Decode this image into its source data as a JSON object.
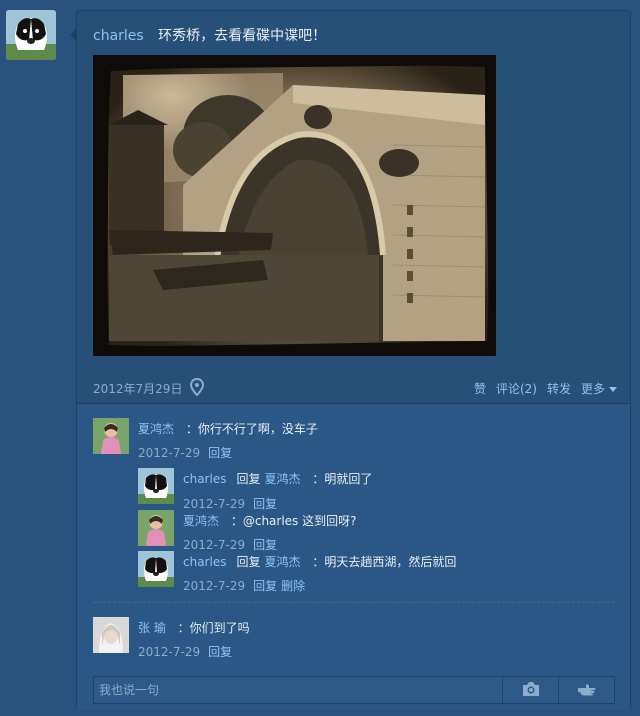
{
  "post": {
    "author": "charles",
    "text": "环秀桥，去看看碟中谍吧！",
    "date": "2012年7月29日",
    "actions": {
      "like": "赞",
      "comment": "评论(2)",
      "share": "转发",
      "more": "更多"
    }
  },
  "comments": [
    {
      "author": "夏鸿杰",
      "text": "：你行不行了啊，没车子",
      "date": "2012-7-29",
      "reply_label": "回复"
    },
    {
      "author": "charles",
      "reply_word": "回复",
      "reply_to": "夏鸿杰",
      "text": "：明就回了",
      "date": "2012-7-29",
      "reply_label": "回复"
    },
    {
      "author": "夏鸿杰",
      "text": "：@charles 这到回呀?",
      "date": "2012-7-29",
      "reply_label": "回复"
    },
    {
      "author": "charles",
      "reply_word": "回复",
      "reply_to": "夏鸿杰",
      "text": "：明天去趟西湖，然后就回",
      "date": "2012-7-29",
      "reply_label": "回复",
      "delete_label": "删除"
    },
    {
      "author": "张 瑜",
      "text": "：你们到了吗",
      "date": "2012-7-29",
      "reply_label": "回复"
    }
  ],
  "composer": {
    "placeholder": "我也说一句",
    "value": ""
  },
  "icons": {
    "location": "location-pin-icon",
    "camera": "camera-icon",
    "share_hand": "pointing-hand-icon",
    "more_caret": "caret-down-icon"
  },
  "colors": {
    "background": "#2a527e",
    "link": "#8ec3f0",
    "muted": "#8daccb"
  }
}
